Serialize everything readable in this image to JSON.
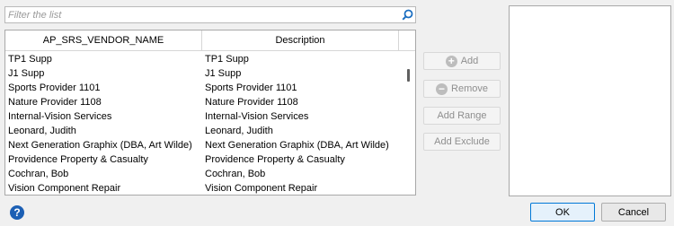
{
  "filter": {
    "placeholder": "Filter the list"
  },
  "grid": {
    "columns": [
      "AP_SRS_VENDOR_NAME",
      "Description"
    ],
    "rows": [
      [
        "TP1 Supp",
        "TP1 Supp"
      ],
      [
        "J1 Supp",
        "J1 Supp"
      ],
      [
        "Sports Provider 1101",
        "Sports Provider 1101"
      ],
      [
        "Nature Provider 1108",
        "Nature Provider 1108"
      ],
      [
        "Internal-Vision Services",
        "Internal-Vision Services"
      ],
      [
        "Leonard, Judith",
        "Leonard, Judith"
      ],
      [
        "Next Generation Graphix (DBA, Art Wilde)",
        "Next Generation Graphix (DBA, Art Wilde)"
      ],
      [
        "Providence Property & Casualty",
        "Providence Property & Casualty"
      ],
      [
        "Cochran, Bob",
        "Cochran, Bob"
      ],
      [
        "Vision Component Repair",
        "Vision Component Repair"
      ]
    ]
  },
  "actions": {
    "add": "Add",
    "remove": "Remove",
    "add_range": "Add Range",
    "add_exclude": "Add Exclude"
  },
  "footer": {
    "ok": "OK",
    "cancel": "Cancel",
    "help_glyph": "?"
  },
  "colors": {
    "help_blue": "#1c5fb4",
    "ok_border": "#0078d7",
    "search_icon": "#1c6fc1"
  }
}
